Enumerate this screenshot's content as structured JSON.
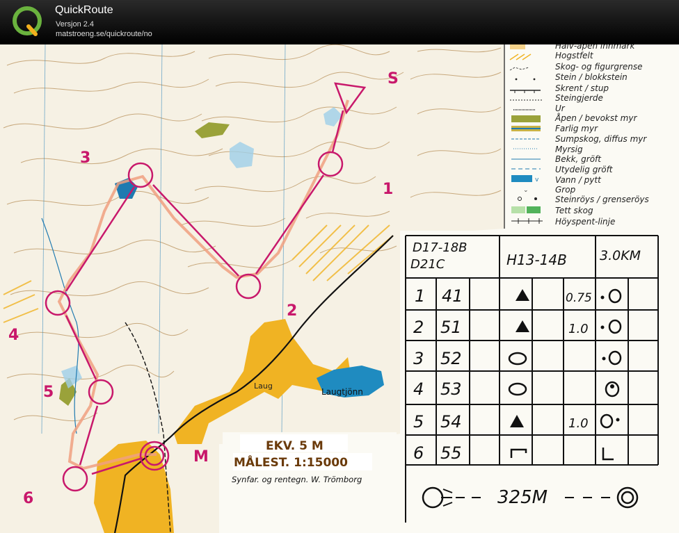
{
  "app": {
    "name": "QuickRoute",
    "version": "Versjon 2.4",
    "url": "matstroeng.se/quickroute/no"
  },
  "map": {
    "controls": [
      {
        "label": "S"
      },
      {
        "label": "1"
      },
      {
        "label": "2"
      },
      {
        "label": "3"
      },
      {
        "label": "4"
      },
      {
        "label": "5"
      },
      {
        "label": "6"
      },
      {
        "label": "M"
      }
    ],
    "place_names": {
      "laug": "Laug",
      "lake": "Laugtjönn"
    },
    "info_box": {
      "equidistance": "EKV. 5 M",
      "scale": "MÅLEST. 1:15000",
      "credit": "Synfar. og rentegn. W. Trömborg"
    },
    "legend": [
      "Halv-åpen innmark",
      "Hogstfelt",
      "Skog- og figurgrense",
      "Stein / blokkstein",
      "Skrent / stup",
      "Steingjerde",
      "Ur",
      "Åpen / bevokst myr",
      "Farlig myr",
      "Sumpskog, diffus myr",
      "Myrsig",
      "Bekk, gröft",
      "Utydelig gröft",
      "Vann / pytt",
      "Grop",
      "Steinröys / grenseröys",
      "Tett skog",
      "Höyspent-linje"
    ],
    "control_card": {
      "classes_1": "D17-18B",
      "classes_2": "D21C",
      "classes_3": "H13-14B",
      "length": "3.0KM",
      "rows": [
        {
          "num": "1",
          "code": "41",
          "feature": "triangle",
          "size": "0.75",
          "position": "•O"
        },
        {
          "num": "2",
          "code": "51",
          "feature": "triangle",
          "size": "1.0",
          "position": "•O"
        },
        {
          "num": "3",
          "code": "52",
          "feature": "oval",
          "size": "",
          "position": "•O"
        },
        {
          "num": "4",
          "code": "53",
          "feature": "oval",
          "size": "",
          "position": "dotted-circle"
        },
        {
          "num": "5",
          "code": "54",
          "feature": "triangle",
          "size": "1.0",
          "position": "O•"
        },
        {
          "num": "6",
          "code": "55",
          "feature": "cliff",
          "size": "",
          "position": "L"
        }
      ],
      "finish_distance": "325M"
    },
    "colors": {
      "course": "#c8186b",
      "route": "#f0a080",
      "yellow": "#f0b323",
      "water": "#1f8bc0"
    }
  }
}
